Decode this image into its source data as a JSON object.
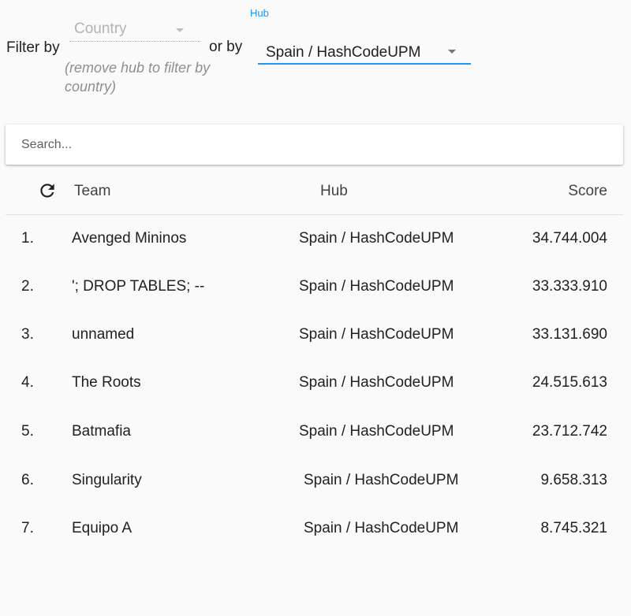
{
  "filter": {
    "filter_by_label": "Filter by",
    "or_by_label": "or by",
    "country_value": "Country",
    "helper_text": "(remove hub to filter by country)",
    "hub_label": "Hub",
    "hub_value": "Spain / HashCodeUPM"
  },
  "search": {
    "placeholder": "Search..."
  },
  "table": {
    "headers": {
      "team": "Team",
      "hub": "Hub",
      "score": "Score"
    },
    "rows": [
      {
        "rank": "1.",
        "team": "Avenged Mininos",
        "hub": "Spain / HashCodeUPM",
        "score": "34.744.004"
      },
      {
        "rank": "2.",
        "team": "'; DROP TABLES; --",
        "hub": "Spain / HashCodeUPM",
        "score": "33.333.910"
      },
      {
        "rank": "3.",
        "team": "unnamed",
        "hub": "Spain / HashCodeUPM",
        "score": "33.131.690"
      },
      {
        "rank": "4.",
        "team": "The Roots",
        "hub": "Spain / HashCodeUPM",
        "score": "24.515.613"
      },
      {
        "rank": "5.",
        "team": "Batmafia",
        "hub": "Spain / HashCodeUPM",
        "score": "23.712.742"
      },
      {
        "rank": "6.",
        "team": "Singularity",
        "hub": "Spain / HashCodeUPM",
        "score": "9.658.313"
      },
      {
        "rank": "7.",
        "team": "Equipo A",
        "hub": "Spain / HashCodeUPM",
        "score": "8.745.321"
      }
    ]
  },
  "icons": {
    "refresh": "refresh-icon",
    "dropdown": "arrow-drop-down-icon"
  },
  "colors": {
    "accent": "#2196f3",
    "background": "#fafafa"
  }
}
